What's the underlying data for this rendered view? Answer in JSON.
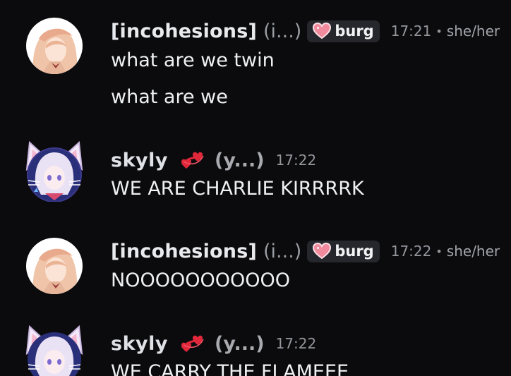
{
  "messages": [
    {
      "username": "[incohesions]",
      "nickname": "(i...)",
      "tag": "burg",
      "time": "17:21",
      "dot": "•",
      "pronouns": "she/her",
      "lines": [
        "what are we twin",
        "what are we"
      ]
    },
    {
      "username": "skyly",
      "nickname": "(y...)",
      "time": "17:22",
      "lines": [
        "WE ARE CHARLIE KIRRRRK"
      ]
    },
    {
      "username": "[incohesions]",
      "nickname": "(i...)",
      "tag": "burg",
      "time": "17:22",
      "dot": "•",
      "pronouns": "she/her",
      "lines": [
        "NOOOOOOOOOOO"
      ]
    },
    {
      "username": "skyly",
      "nickname": "(y...)",
      "time": "17:22",
      "lines": [
        "WE CARRY THE FLAMEEE"
      ]
    }
  ],
  "colors": {
    "background": "#0b0b0d",
    "tag_background": "#26272c",
    "heart_pink": "#f08a9c",
    "deco_red": "#e0283a"
  },
  "icons": [
    "heart-tag-icon",
    "heart-decoration-icon"
  ]
}
